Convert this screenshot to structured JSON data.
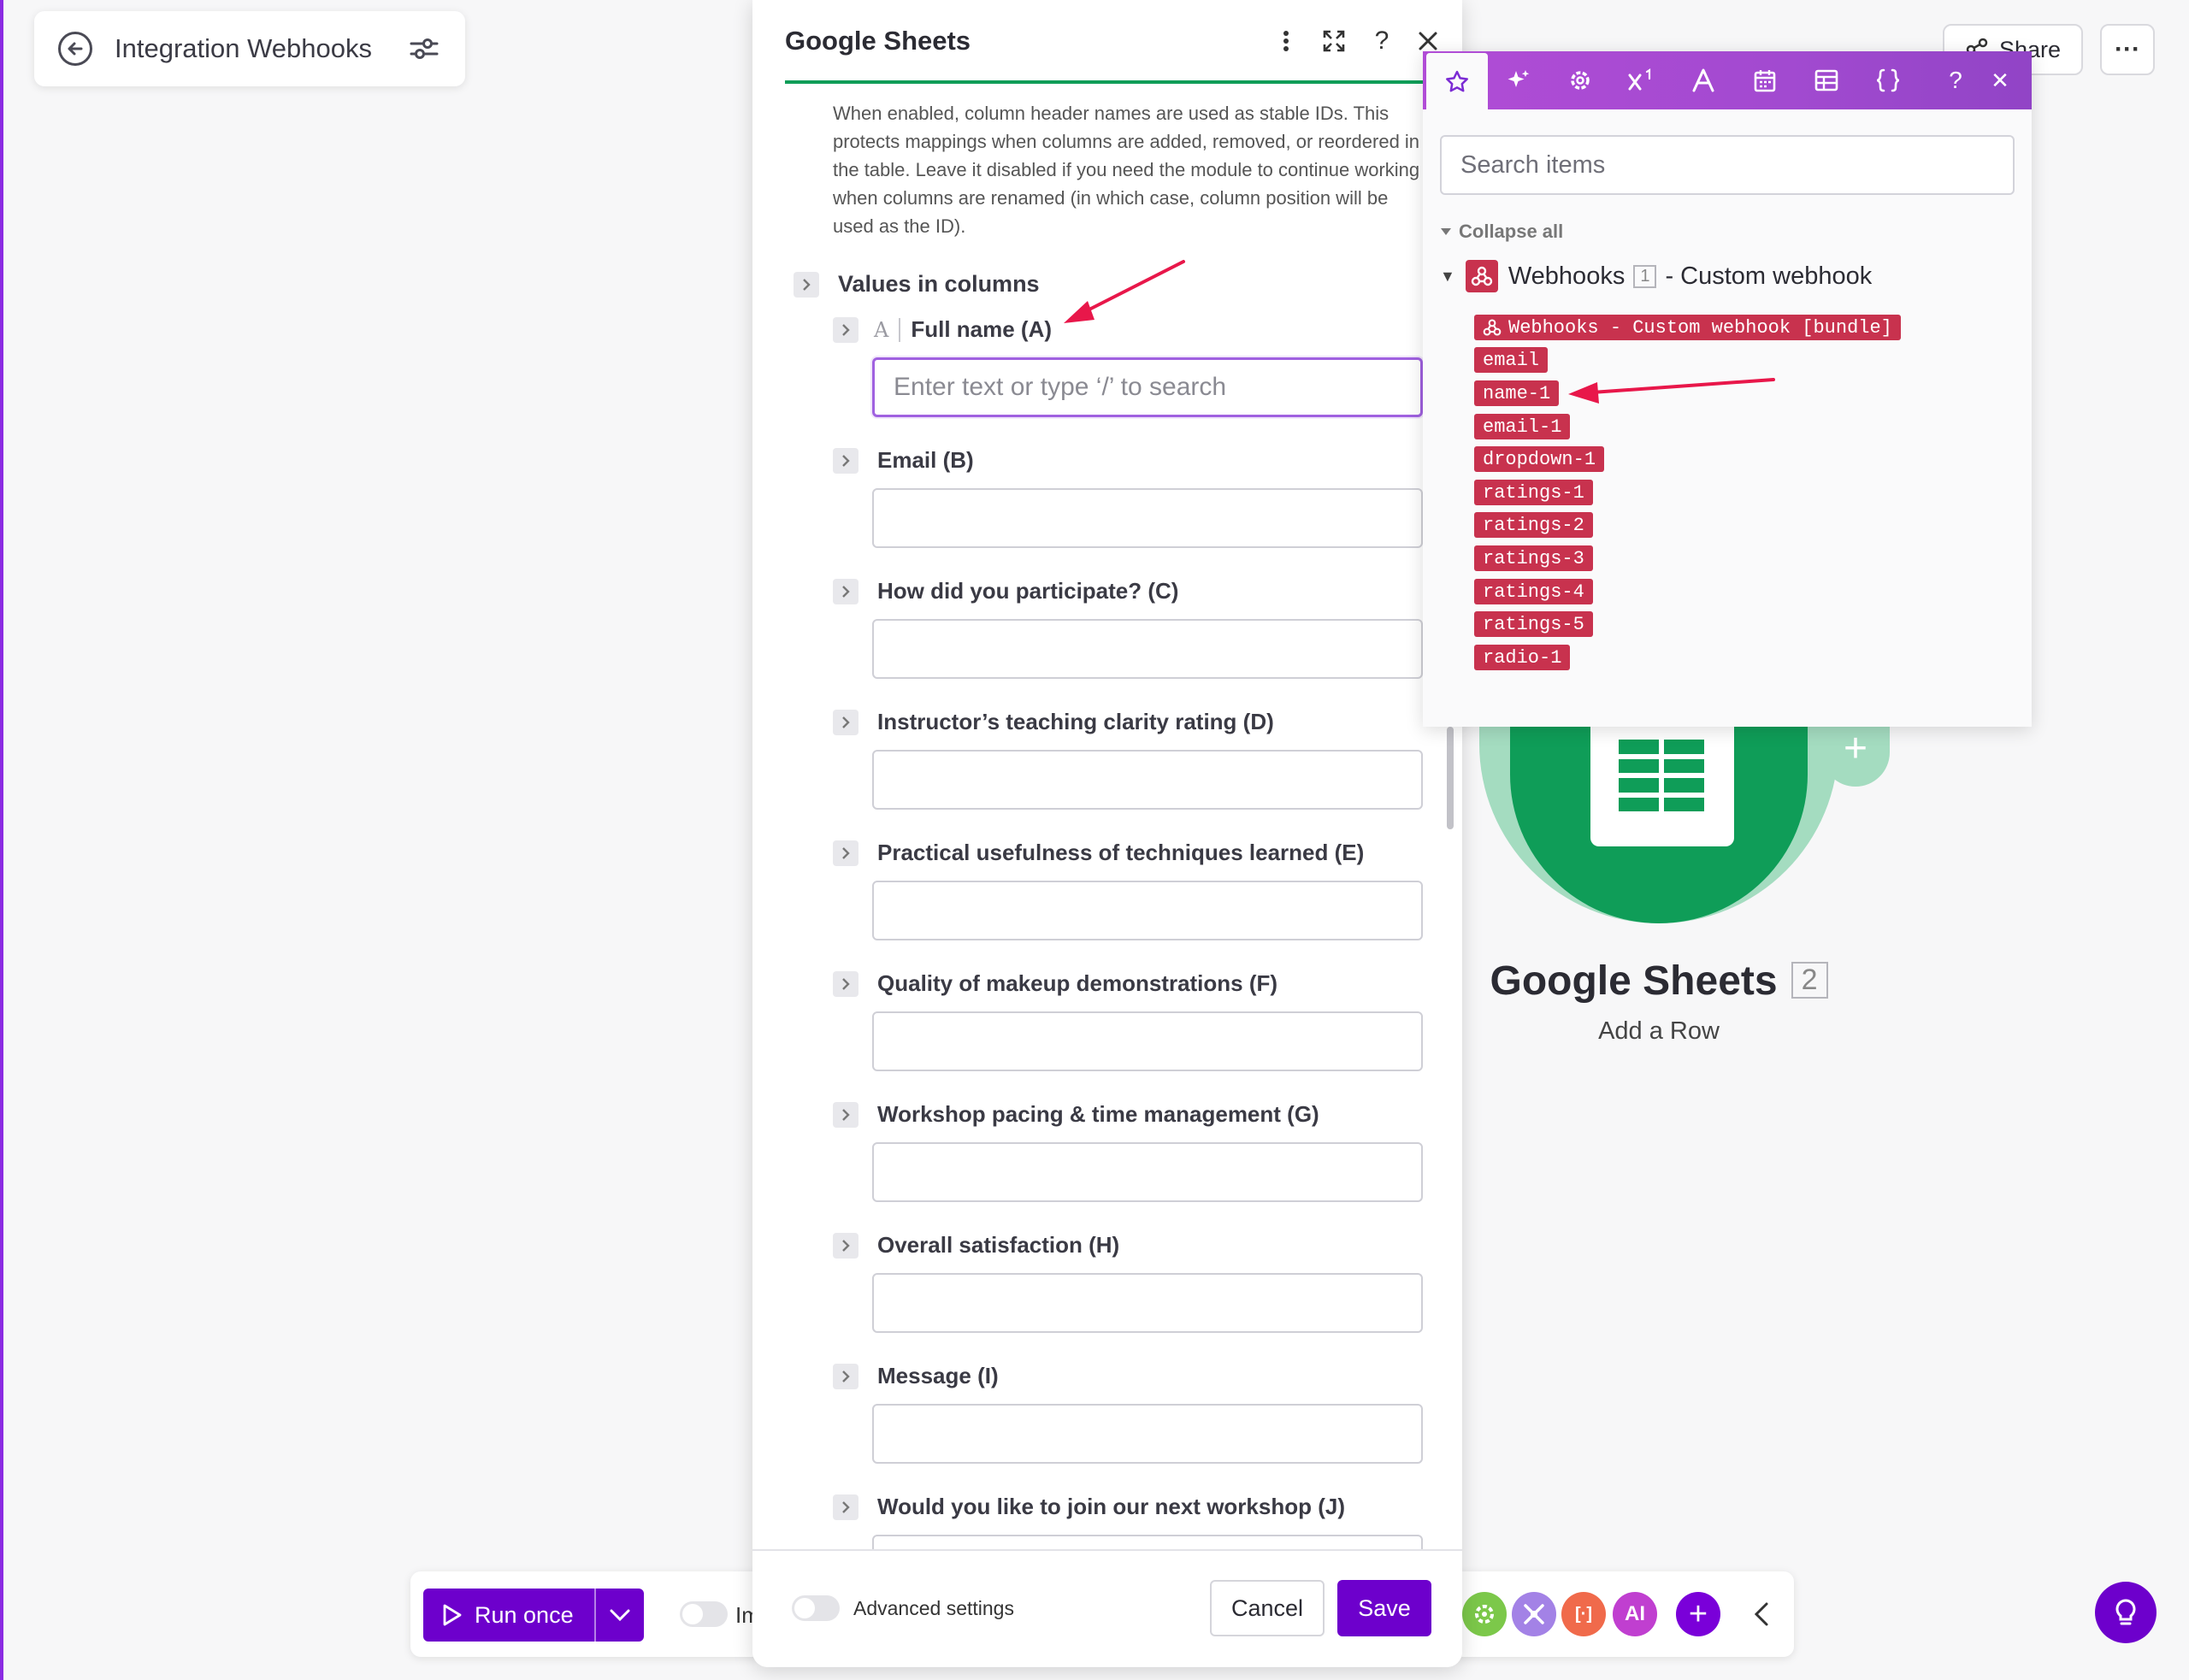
{
  "scenario": {
    "title": "Integration Webhooks"
  },
  "topbar": {
    "share_label": "Share",
    "more_label": "···"
  },
  "canvas_module": {
    "title": "Google Sheets",
    "number": "2",
    "subtitle": "Add a Row"
  },
  "bottom_toolbar": {
    "run_once_label": "Run once",
    "immediately_label": "Im",
    "tools": [
      {
        "icon": "gear-icon",
        "color": "#7cc84a"
      },
      {
        "icon": "tools-icon",
        "color": "#a382e6"
      },
      {
        "icon": "flow-control-icon",
        "color": "#f06a4b",
        "label": "[·]"
      },
      {
        "icon": "ai-icon",
        "color": "#c03fd0",
        "label": "AI"
      },
      {
        "icon": "plus-icon",
        "color": "#7a00d9",
        "label": "+"
      }
    ]
  },
  "dialog": {
    "title": "Google Sheets",
    "help_text": "When enabled, column header names are used as stable IDs. This protects mappings when columns are added, removed, or reordered in the table. Leave it disabled if you need the module to continue working when columns are renamed (in which case, column position will be used as the ID).",
    "section_label": "Values in columns",
    "first_field": {
      "type_marker": "A",
      "label": "Full name (A)",
      "placeholder": "Enter text or type ‘/’ to search"
    },
    "fields": [
      {
        "label": "Email (B)"
      },
      {
        "label": "How did you participate? (C)"
      },
      {
        "label": "Instructor’s teaching clarity rating (D)"
      },
      {
        "label": "Practical usefulness of techniques learned (E)"
      },
      {
        "label": "Quality of makeup demonstrations (F)"
      },
      {
        "label": "Workshop pacing & time management (G)"
      },
      {
        "label": "Overall satisfaction (H)"
      },
      {
        "label": "Message (I)"
      },
      {
        "label": "Would you like to join our next workshop (J)"
      }
    ],
    "advanced_label": "Advanced settings",
    "cancel_label": "Cancel",
    "save_label": "Save"
  },
  "mapping_panel": {
    "tabs": [
      "star-icon",
      "sparkle-icon",
      "gear-icon",
      "superscript-icon",
      "text-icon",
      "calendar-icon",
      "table-icon",
      "braces-icon"
    ],
    "help_label": "?",
    "close_label": "✕",
    "search_placeholder": "Search items",
    "collapse_all_label": "Collapse all",
    "tree": {
      "module_name": "Webhooks",
      "module_number": "1",
      "module_rest": "- Custom webhook"
    },
    "items": [
      "Webhooks - Custom webhook [bundle]",
      "email",
      "name-1",
      "email-1",
      "dropdown-1",
      "ratings-1",
      "ratings-2",
      "ratings-3",
      "ratings-4",
      "ratings-5",
      "radio-1"
    ]
  },
  "colors": {
    "accent_purple": "#6d00cc",
    "sheets_green": "#0f9d58",
    "pill_red": "#c8324e",
    "annotation_arrow": "#e8174a"
  }
}
